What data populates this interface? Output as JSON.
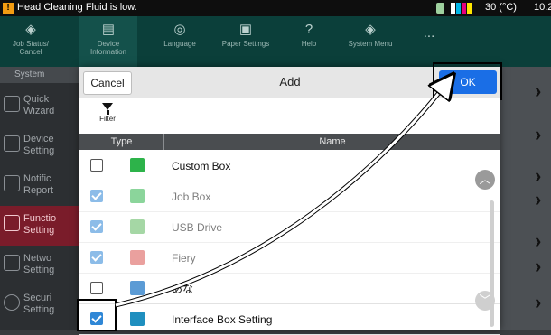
{
  "status_bar": {
    "warning_icon": "warning-icon",
    "message": "Head Cleaning Fluid is low.",
    "toner_colors": [
      "#ffffff",
      "#00b5e6",
      "#e6007e",
      "#ffe600"
    ],
    "temperature": "30 (°C)",
    "time": "10:2"
  },
  "topnav": {
    "items": [
      {
        "label_1": "Job Status/",
        "label_2": "Cancel",
        "icon": "job-status-icon"
      },
      {
        "label_1": "Device",
        "label_2": "Information",
        "icon": "device-information-icon"
      },
      {
        "label_1": "Language",
        "label_2": "",
        "icon": "language-icon"
      },
      {
        "label_1": "Paper Settings",
        "label_2": "",
        "icon": "paper-settings-icon"
      },
      {
        "label_1": "Help",
        "label_2": "",
        "icon": "help-icon"
      },
      {
        "label_1": "System Menu",
        "label_2": "",
        "icon": "system-menu-icon"
      },
      {
        "label_1": "...",
        "label_2": "",
        "icon": "more-icon"
      }
    ]
  },
  "sidebar": {
    "title": "System",
    "items": [
      {
        "line1": "Quick",
        "line2": "Wizard"
      },
      {
        "line1": "Device",
        "line2": "Setting"
      },
      {
        "line1": "Notific",
        "line2": "Report"
      },
      {
        "line1": "Functio",
        "line2": "Setting"
      },
      {
        "line1": "Netwo",
        "line2": "Setting"
      },
      {
        "line1": "Securi",
        "line2": "Setting"
      }
    ]
  },
  "dialog": {
    "title": "Add",
    "cancel_label": "Cancel",
    "ok_label": "OK",
    "filter_label": "Filter",
    "columns": {
      "type": "Type",
      "name": "Name"
    },
    "rows": [
      {
        "name": "Custom Box",
        "checked": false,
        "dim": false,
        "icon": "folder-icon",
        "icon_color": "#2db34a"
      },
      {
        "name": "Job Box",
        "checked": true,
        "dim": true,
        "icon": "job-box-icon",
        "icon_color": "#2db34a"
      },
      {
        "name": "USB Drive",
        "checked": true,
        "dim": true,
        "icon": "usb-drive-icon",
        "icon_color": "#5cb85c"
      },
      {
        "name": "Fiery",
        "checked": true,
        "dim": true,
        "icon": "fiery-icon",
        "icon_color": "#d9534f"
      },
      {
        "name": "あな",
        "checked": false,
        "dim": false,
        "icon": "app-icon",
        "icon_color": "#5b9bd5"
      },
      {
        "name": "Interface Box Setting",
        "checked": true,
        "dim": false,
        "icon": "interface-box-icon",
        "icon_color": "#1f8fbf"
      }
    ]
  }
}
